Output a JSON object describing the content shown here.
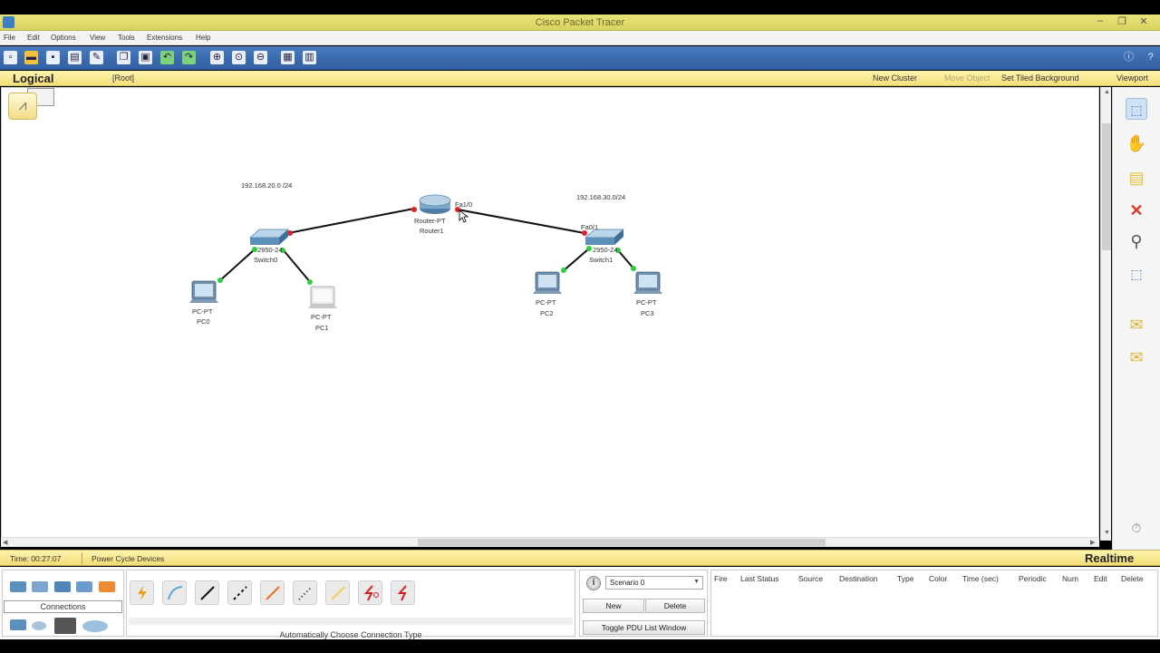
{
  "window": {
    "title": "Cisco Packet Tracer",
    "minimize": "–",
    "restore": "❐",
    "close": "✕"
  },
  "menu": [
    "File",
    "Edit",
    "Options",
    "View",
    "Tools",
    "Extensions",
    "Help"
  ],
  "logical_bar": {
    "mode": "Logical",
    "root": "[Root]",
    "new_cluster": "New Cluster",
    "move_object": "Move Object",
    "set_background": "Set Tiled Background",
    "viewport": "Viewport"
  },
  "network": {
    "subnet_left": "192.168.20.0 /24",
    "subnet_right": "192.168.30.0/24",
    "router": {
      "model": "Router-PT",
      "name": "Router1",
      "port": "Fa1/0"
    },
    "switch0": {
      "model": "2950-24",
      "name": "Switch0"
    },
    "switch1": {
      "model": "2950-24",
      "name": "Switch1",
      "port": "Fa0/1"
    },
    "pcs": [
      {
        "model": "PC-PT",
        "name": "PC0"
      },
      {
        "model": "PC-PT",
        "name": "PC1"
      },
      {
        "model": "PC-PT",
        "name": "PC2"
      },
      {
        "model": "PC-PT",
        "name": "PC3"
      }
    ]
  },
  "status_bar": {
    "time": "Time: 00:27:07",
    "power_cycle": "Power Cycle Devices",
    "mode": "Realtime"
  },
  "bottom": {
    "connections_label": "Connections",
    "auto_connection": "Automatically Choose Connection Type",
    "scenario": "Scenario 0",
    "new_btn": "New",
    "delete_btn": "Delete",
    "toggle_pdu": "Toggle PDU List Window",
    "pdu_columns": [
      "Fire",
      "Last Status",
      "Source",
      "Destination",
      "Type",
      "Color",
      "Time (sec)",
      "Periodic",
      "Num",
      "Edit",
      "Delete"
    ]
  },
  "colors": {
    "toolbar": "#3a6cb0",
    "title_bar": "#e2dd6c",
    "link_up": "#2ecc40",
    "link_down": "#e0202a"
  }
}
